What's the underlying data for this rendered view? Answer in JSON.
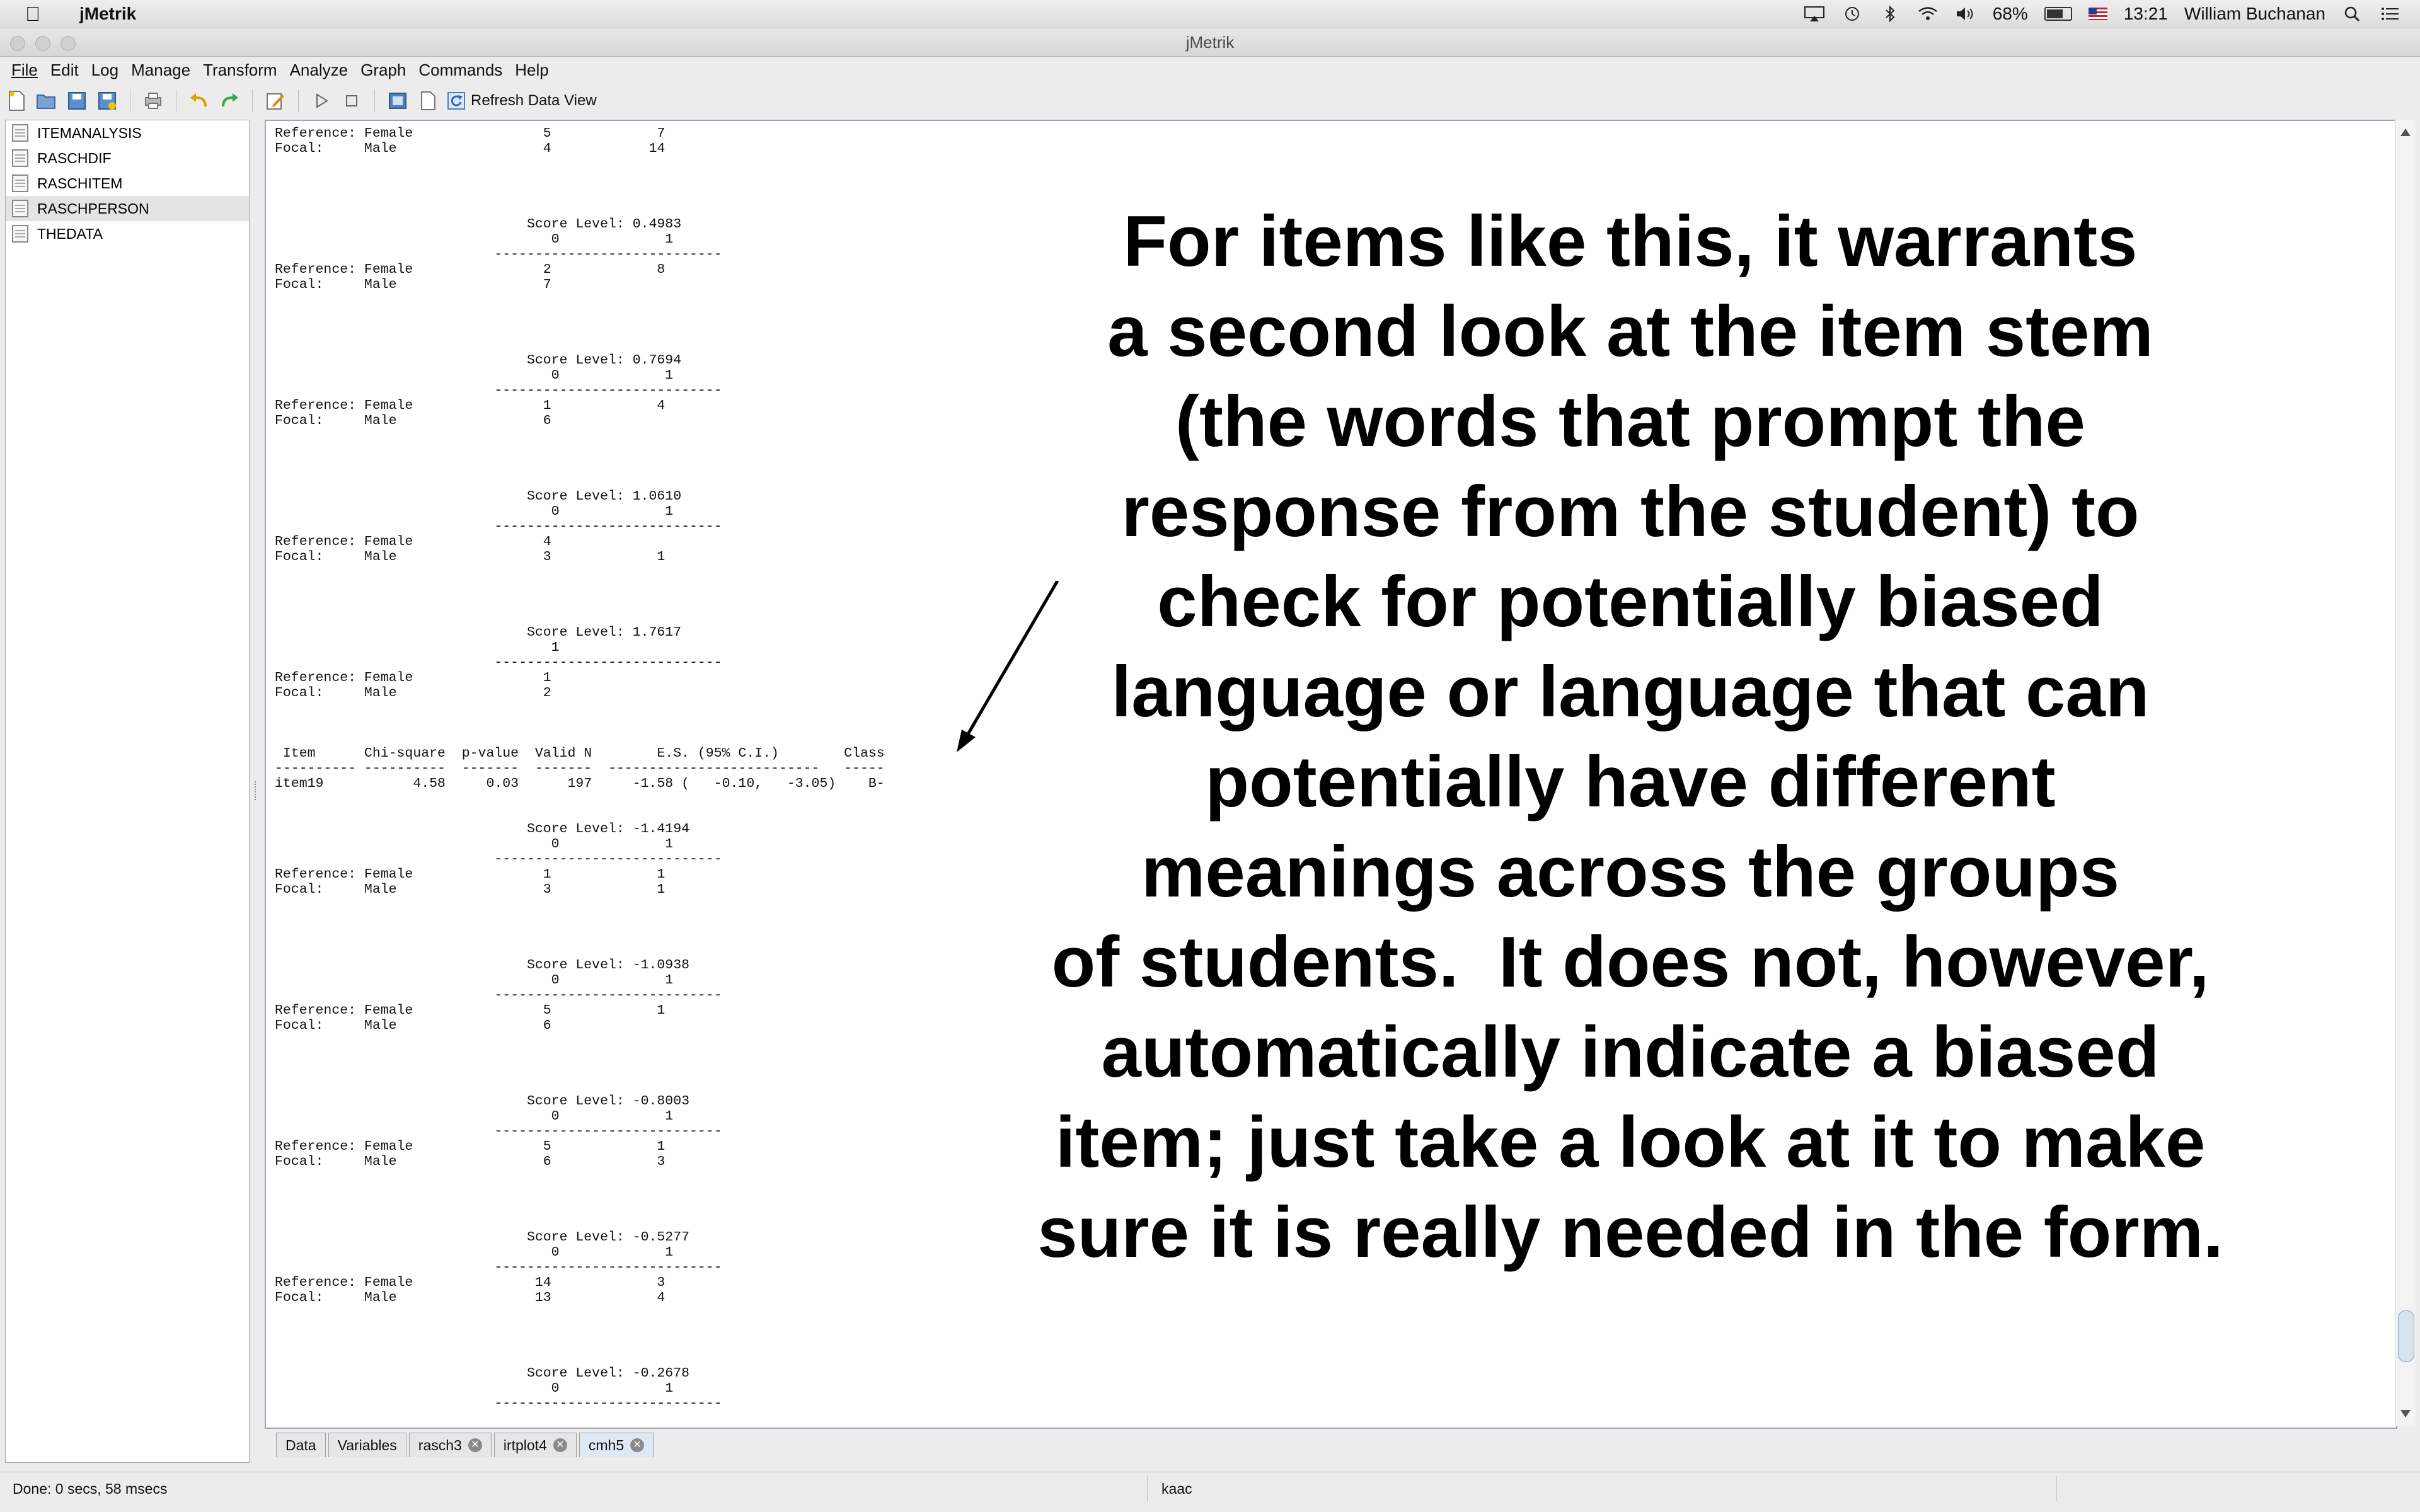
{
  "macos_menubar": {
    "app_name": "jMetrik",
    "battery": "68%",
    "time": "13:21",
    "user": "William Buchanan"
  },
  "window": {
    "title": "jMetrik"
  },
  "app_menu": [
    "File",
    "Edit",
    "Log",
    "Manage",
    "Transform",
    "Analyze",
    "Graph",
    "Commands",
    "Help"
  ],
  "toolbar": {
    "refresh_label": "Refresh Data View"
  },
  "tree": {
    "items": [
      "ITEMANALYSIS",
      "RASCHDIF",
      "RASCHITEM",
      "RASCHPERSON",
      "THEDATA"
    ],
    "selected": "RASCHPERSON"
  },
  "output_text": "Reference: Female                5             7\nFocal:     Male                  4            14\n\n\n\n\n                               Score Level: 0.4983\n                                  0             1\n                           ----------------------------\nReference: Female                2             8\nFocal:     Male                  7\n\n\n\n\n                               Score Level: 0.7694\n                                  0             1\n                           ----------------------------\nReference: Female                1             4\nFocal:     Male                  6\n\n\n\n\n                               Score Level: 1.0610\n                                  0             1\n                           ----------------------------\nReference: Female                4\nFocal:     Male                  3             1\n\n\n\n\n                               Score Level: 1.7617\n                                  1\n                           ----------------------------\nReference: Female                1\nFocal:     Male                  2\n\n\n\n Item      Chi-square  p-value  Valid N        E.S. (95% C.I.)        Class\n---------- ----------  -------  -------  --------------------------   -----\nitem19           4.58     0.03      197     -1.58 (   -0.10,   -3.05)    B-\n\n\n                               Score Level: -1.4194\n                                  0             1\n                           ----------------------------\nReference: Female                1             1\nFocal:     Male                  3             1\n\n\n\n\n                               Score Level: -1.0938\n                                  0             1\n                           ----------------------------\nReference: Female                5             1\nFocal:     Male                  6\n\n\n\n\n                               Score Level: -0.8003\n                                  0             1\n                           ----------------------------\nReference: Female                5             1\nFocal:     Male                  6             3\n\n\n\n\n                               Score Level: -0.5277\n                                  0             1\n                           ----------------------------\nReference: Female               14             3\nFocal:     Male                 13             4\n\n\n\n\n                               Score Level: -0.2678\n                                  0             1\n                           ----------------------------",
  "annotation": "For items like this, it warrants\na second look at the item stem\n(the words that prompt the\nresponse from the student) to\ncheck for potentially biased\nlanguage or language that can\npotentially have different\nmeanings across the groups\nof students.  It does not, however,\nautomatically indicate a biased\nitem; just take a look at it to make\nsure it is really needed in the form.",
  "tabs": [
    {
      "label": "Data",
      "closable": false
    },
    {
      "label": "Variables",
      "closable": false
    },
    {
      "label": "rasch3",
      "closable": true
    },
    {
      "label": "irtplot4",
      "closable": true
    },
    {
      "label": "cmh5",
      "closable": true,
      "active": true
    }
  ],
  "status": {
    "left": "Done: 0 secs, 58 msecs",
    "middle": "kaac"
  }
}
